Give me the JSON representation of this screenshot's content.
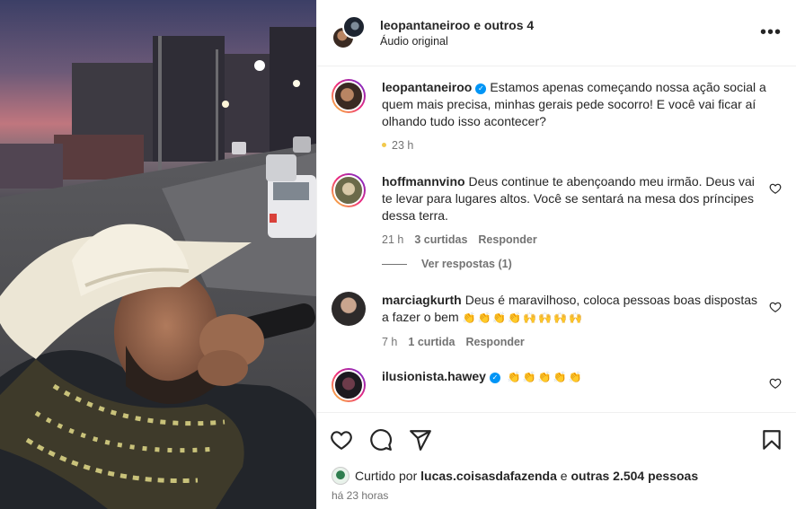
{
  "header": {
    "username": "leopantaneiroo",
    "others": "e outros 4",
    "subtitle": "Áudio original",
    "more_label": "•••"
  },
  "caption": {
    "username": "leopantaneiroo",
    "text": "Estamos apenas começando nossa ação social a quem mais precisa, minhas gerais pede socorro! E você vai ficar aí olhando tudo isso acontecer?",
    "time": "23 h"
  },
  "comments": [
    {
      "username": "hoffmannvino",
      "text": "Deus continue te abençoando meu irmão. Deus vai te levar para lugares altos. Você se sentará na mesa dos príncipes dessa terra.",
      "time": "21 h",
      "likes": "3 curtidas",
      "reply": "Responder",
      "view_replies": "Ver respostas (1)"
    },
    {
      "username": "marciagkurth",
      "text": "Deus é maravilhoso, coloca pessoas boas dispostas a fazer o bem",
      "emoji": "👏👏👏👏🙌🙌🙌🙌",
      "time": "7 h",
      "likes": "1 curtida",
      "reply": "Responder"
    },
    {
      "username": "ilusionista.hawey",
      "emoji": "👏👏👏👏👏"
    }
  ],
  "likes": {
    "prefix": "Curtido por",
    "user": "lucas.coisasdafazenda",
    "middle": "e",
    "others": "outras 2.504 pessoas"
  },
  "posted": "há 23 horas",
  "colors": {
    "accent": "#0095f6",
    "muted": "#737373",
    "text": "#262626"
  },
  "icons": [
    "heart-icon",
    "comment-icon",
    "share-icon",
    "bookmark-icon",
    "more-icon",
    "verified-icon"
  ]
}
